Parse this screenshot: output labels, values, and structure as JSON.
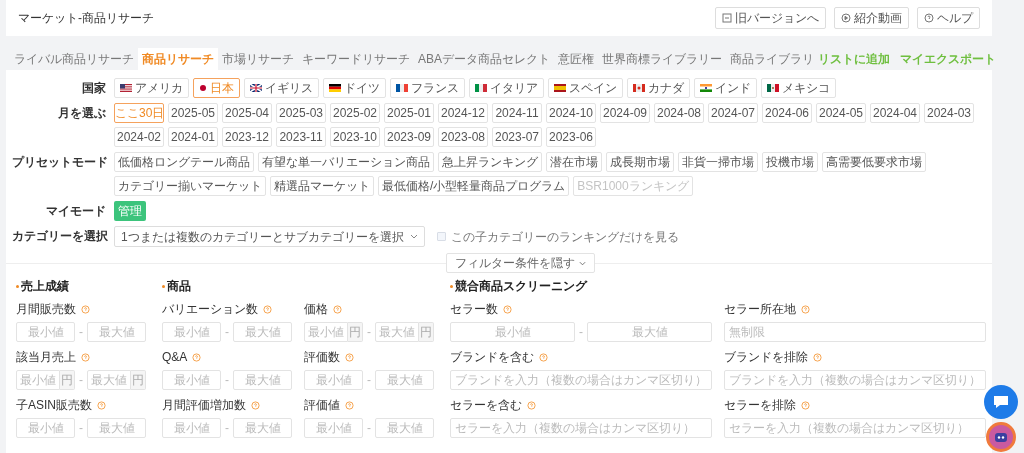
{
  "header": {
    "title": "マーケット-商品リサーチ",
    "buttons": [
      {
        "kind": "old",
        "label": "旧バージョンへ"
      },
      {
        "kind": "video",
        "label": "紹介動画"
      },
      {
        "kind": "help",
        "label": "ヘルプ"
      }
    ]
  },
  "tabs": [
    {
      "label": "ライバル商品リサーチ",
      "selected": false
    },
    {
      "label": "商品リサーチ",
      "selected": true
    },
    {
      "label": "市場リサーチ",
      "selected": false
    },
    {
      "label": "キーワードリサーチ",
      "selected": false
    },
    {
      "label": "ABAデータ商品セレクト",
      "selected": false
    },
    {
      "label": "意匠権",
      "selected": false
    },
    {
      "label": "世界商標ライブラリー",
      "selected": false
    },
    {
      "label": "商品ライブラリ",
      "selected": false
    }
  ],
  "tab_links": [
    "リストに追加",
    "マイエクスポート"
  ],
  "countries": {
    "label": "国家",
    "items": [
      {
        "label": "アメリカ",
        "selected": false
      },
      {
        "label": "日本",
        "selected": true
      },
      {
        "label": "イギリス",
        "selected": false
      },
      {
        "label": "ドイツ",
        "selected": false
      },
      {
        "label": "フランス",
        "selected": false
      },
      {
        "label": "イタリア",
        "selected": false
      },
      {
        "label": "スペイン",
        "selected": false
      },
      {
        "label": "カナダ",
        "selected": false
      },
      {
        "label": "インド",
        "selected": false
      },
      {
        "label": "メキシコ",
        "selected": false
      }
    ]
  },
  "months": {
    "label": "月を選ぶ",
    "items": [
      {
        "label": "ここ30日",
        "selected": true
      },
      {
        "label": "2025-05",
        "selected": false
      },
      {
        "label": "2025-04",
        "selected": false
      },
      {
        "label": "2025-03",
        "selected": false
      },
      {
        "label": "2025-02",
        "selected": false
      },
      {
        "label": "2025-01",
        "selected": false
      },
      {
        "label": "2024-12",
        "selected": false
      },
      {
        "label": "2024-11",
        "selected": false
      },
      {
        "label": "2024-10",
        "selected": false
      },
      {
        "label": "2024-09",
        "selected": false
      },
      {
        "label": "2024-08",
        "selected": false
      },
      {
        "label": "2024-07",
        "selected": false
      },
      {
        "label": "2024-06",
        "selected": false
      },
      {
        "label": "2024-05",
        "selected": false
      },
      {
        "label": "2024-04",
        "selected": false
      },
      {
        "label": "2024-03",
        "selected": false
      },
      {
        "label": "2024-02",
        "selected": false
      },
      {
        "label": "2024-01",
        "selected": false
      },
      {
        "label": "2023-12",
        "selected": false
      },
      {
        "label": "2023-11",
        "selected": false
      },
      {
        "label": "2023-10",
        "selected": false
      },
      {
        "label": "2023-09",
        "selected": false
      },
      {
        "label": "2023-08",
        "selected": false
      },
      {
        "label": "2023-07",
        "selected": false
      },
      {
        "label": "2023-06",
        "selected": false
      }
    ]
  },
  "presets": {
    "label": "プリセットモード",
    "items": [
      {
        "label": "低価格ロングテール商品",
        "disabled": false
      },
      {
        "label": "有望な単一バリエーション商品",
        "disabled": false
      },
      {
        "label": "急上昇ランキング",
        "disabled": false
      },
      {
        "label": "潜在市場",
        "disabled": false
      },
      {
        "label": "成長期市場",
        "disabled": false
      },
      {
        "label": "非貨一掃市場",
        "disabled": false
      },
      {
        "label": "投機市場",
        "disabled": false
      },
      {
        "label": "高需要低要求市場",
        "disabled": false
      },
      {
        "label": "カテゴリー揃いマーケット",
        "disabled": false
      },
      {
        "label": "精選品マーケット",
        "disabled": false
      },
      {
        "label": "最低価格/小型軽量商品プログラム",
        "disabled": false
      },
      {
        "label": "BSR1000ランキング",
        "disabled": true
      }
    ]
  },
  "my_mode": {
    "label": "マイモード",
    "button": "管理"
  },
  "category": {
    "label": "カテゴリーを選択",
    "select": "1つまたは複数のカテゴリーとサブカテゴリーを選択",
    "checkbox": {
      "label": "この子カテゴリーのランキングだけを見る",
      "checked": false
    }
  },
  "filter_toggle": "フィルター条件を隠す",
  "sections": [
    {
      "title": "売上成績",
      "fields": [
        {
          "kind": "range",
          "label": "月間販売数",
          "inputs": [
            {
              "placeholder": "最小値"
            },
            {
              "placeholder": "最大値"
            }
          ],
          "separator": "-"
        },
        {
          "kind": "range",
          "label": "該当月売上",
          "inputs": [
            {
              "placeholder": "最小値",
              "unit": "円"
            },
            {
              "placeholder": "最大値",
              "unit": "円"
            }
          ],
          "separator": "-"
        },
        {
          "kind": "range",
          "label": "子ASIN販売数",
          "inputs": [
            {
              "placeholder": "最小値"
            },
            {
              "placeholder": "最大値"
            }
          ],
          "separator": "-"
        }
      ]
    },
    {
      "title": "商品",
      "fields": [
        {
          "kind": "range",
          "label": "バリエーション数",
          "inputs": [
            {
              "placeholder": "最小値"
            },
            {
              "placeholder": "最大値"
            }
          ],
          "separator": "-"
        },
        {
          "kind": "range",
          "label": "価格",
          "inputs": [
            {
              "placeholder": "最小値",
              "unit": "円"
            },
            {
              "placeholder": "最大値",
              "unit": "円"
            }
          ],
          "separator": "-"
        },
        {
          "kind": "range",
          "label": "Q&A",
          "inputs": [
            {
              "placeholder": "最小値"
            },
            {
              "placeholder": "最大値"
            }
          ],
          "separator": "-"
        },
        {
          "kind": "range",
          "label": "評価数",
          "inputs": [
            {
              "placeholder": "最小値"
            },
            {
              "placeholder": "最大値"
            }
          ],
          "separator": "-"
        },
        {
          "kind": "range",
          "label": "月間評価増加数",
          "inputs": [
            {
              "placeholder": "最小値"
            },
            {
              "placeholder": "最大値"
            }
          ],
          "separator": "-"
        },
        {
          "kind": "range",
          "label": "評価値",
          "inputs": [
            {
              "placeholder": "最小値"
            },
            {
              "placeholder": "最大値"
            }
          ],
          "separator": "-"
        }
      ]
    },
    {
      "title": "競合商品スクリーニング",
      "fields": [
        {
          "kind": "range",
          "label": "セラー数",
          "inputs": [
            {
              "placeholder": "最小値"
            },
            {
              "placeholder": "最大値"
            }
          ],
          "separator": "-"
        },
        {
          "kind": "text",
          "label": "セラー所在地",
          "placeholder": "無制限"
        },
        {
          "kind": "text",
          "label": "ブランドを含む",
          "placeholder": "ブランドを入力（複数の場合はカンマ区切り）"
        },
        {
          "kind": "text",
          "label": "ブランドを排除",
          "placeholder": "ブランドを入力（複数の場合はカンマ区切り）"
        },
        {
          "kind": "text",
          "label": "セラーを含む",
          "placeholder": "セラーを入力（複数の場合はカンマ区切り）"
        },
        {
          "kind": "text",
          "label": "セラーを排除",
          "placeholder": "セラーを入力（複数の場合はカンマ区切り）"
        }
      ]
    }
  ]
}
